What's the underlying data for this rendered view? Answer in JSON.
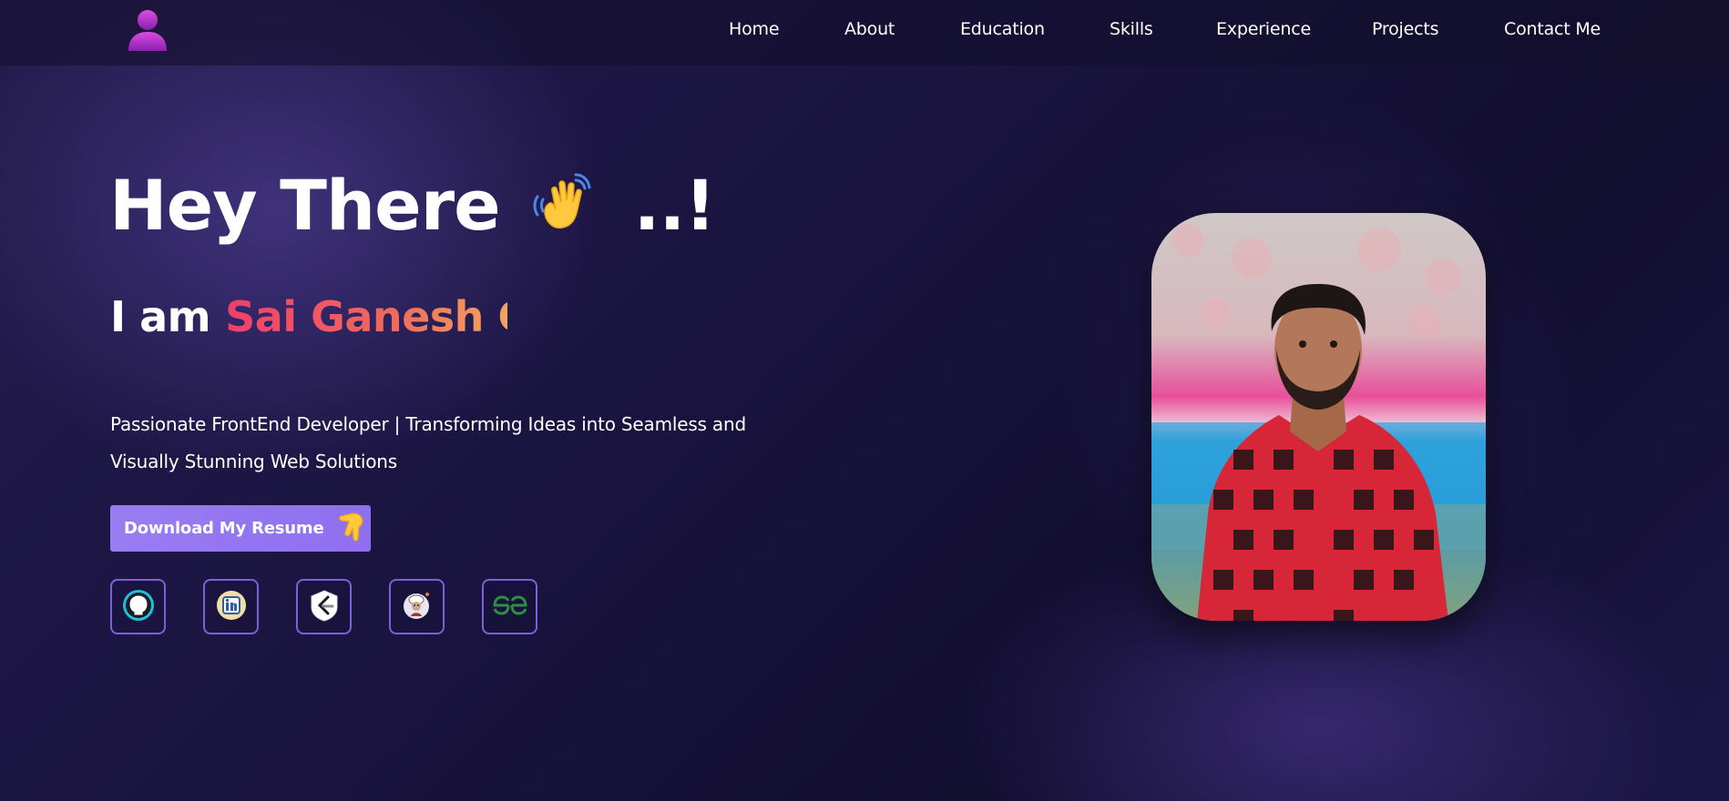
{
  "nav": {
    "links": [
      "Home",
      "About",
      "Education",
      "Skills",
      "Experience",
      "Projects",
      "Contact Me"
    ]
  },
  "hero": {
    "greeting": "Hey There",
    "greeting_suffix": "..!",
    "intro": "I am",
    "name": "Sai Ganesh G",
    "tagline_line1": "Passionate FrontEnd Developer | Transforming Ideas into Seamless and",
    "tagline_line2": "Visually Stunning Web Solutions",
    "resume_button": "Download My Resume"
  },
  "icons": {
    "logo": "user-avatar-icon",
    "wave": "waving-hand-icon",
    "point": "backhand-index-pointing-down-icon",
    "socials": [
      "github-icon",
      "linkedin-icon",
      "leetcode-icon",
      "codechef-icon",
      "geeksforgeeks-icon"
    ]
  },
  "colors": {
    "accent": "#9a7cf1",
    "social_border": "#7a62d6",
    "name_gradient_start": "#ef3f6b",
    "name_gradient_end": "#f3b35a",
    "background": "#1a1440"
  }
}
